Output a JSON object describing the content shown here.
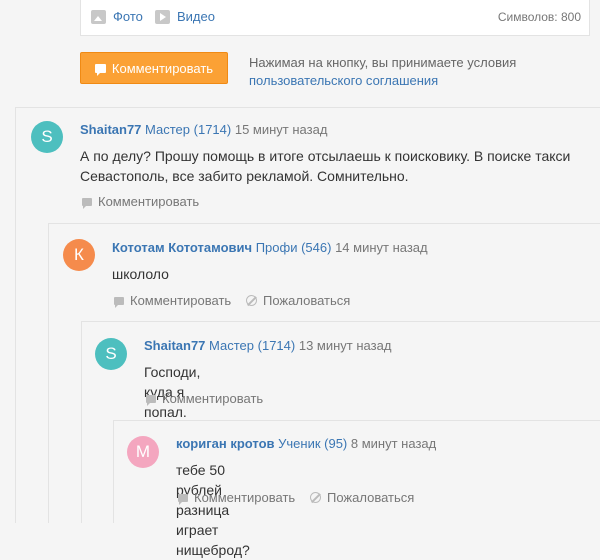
{
  "composer": {
    "photo_label": "Фото",
    "video_label": "Видео",
    "char_count": "Символов: 800"
  },
  "submit": {
    "button_label": "Комментировать",
    "terms_prefix": "Нажимая на кнопку, вы принимаете условия",
    "terms_link": "пользовательского соглашения"
  },
  "colors": {
    "accent": "#fba135",
    "link": "#3b76b3"
  },
  "comments": [
    {
      "avatar_letter": "S",
      "avatar_color": "#4dbfbf",
      "user": "Shaitan77",
      "rank": "Мастер (1714)",
      "time": "15 минут назад",
      "text": "А по делу? Прошу помощь в итоге отсылаешь к поисковику. В поиске такси Севастополь, все забито рекламой. Сомнительно.",
      "reply_label": "Комментировать"
    },
    {
      "avatar_letter": "К",
      "avatar_color": "#f58b4c",
      "user": "Кототам Кототамович",
      "rank": "Профи (546)",
      "time": "14 минут назад",
      "text": "школоло",
      "reply_label": "Комментировать",
      "report_label": "Пожаловаться"
    },
    {
      "avatar_letter": "S",
      "avatar_color": "#4dbfbf",
      "user": "Shaitan77",
      "rank": "Мастер (1714)",
      "time": "13 минут назад",
      "text": "Господи, куда я попал.",
      "reply_label": "Комментировать"
    },
    {
      "avatar_letter": "M",
      "avatar_color": "#f4a6bf",
      "user": "кориган кротов",
      "rank": "Ученик (95)",
      "time": "8 минут назад",
      "text": "тебе 50 рублей разница играет нищеброд?",
      "reply_label": "Комментировать",
      "report_label": "Пожаловаться"
    }
  ]
}
